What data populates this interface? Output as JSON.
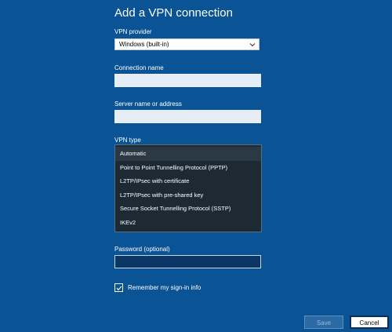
{
  "page_title": "Add a VPN connection",
  "vpn_provider": {
    "label": "VPN provider",
    "selected": "Windows (built-in)"
  },
  "connection_name": {
    "label": "Connection name",
    "value": ""
  },
  "server_name": {
    "label": "Server name or address",
    "value": ""
  },
  "vpn_type": {
    "label": "VPN type",
    "options": [
      "Automatic",
      "Point to Point Tunnelling Protocol (PPTP)",
      "L2TP/IPsec with certificate",
      "L2TP/IPsec with pre-shared key",
      "Secure Socket Tunnelling Protocol (SSTP)",
      "IKEv2"
    ],
    "selected": "Automatic"
  },
  "password": {
    "label": "Password (optional)",
    "value": ""
  },
  "remember": {
    "label": "Remember my sign-in info",
    "checked": true
  },
  "buttons": {
    "save": "Save",
    "cancel": "Cancel"
  },
  "icons": {
    "provider_select": "chevron-down-icon",
    "remember_checkbox": "checkmark-icon"
  },
  "colors": {
    "background": "#0a5395",
    "dropdown_bg": "#1e2a33",
    "dropdown_selected": "#2b3944"
  }
}
